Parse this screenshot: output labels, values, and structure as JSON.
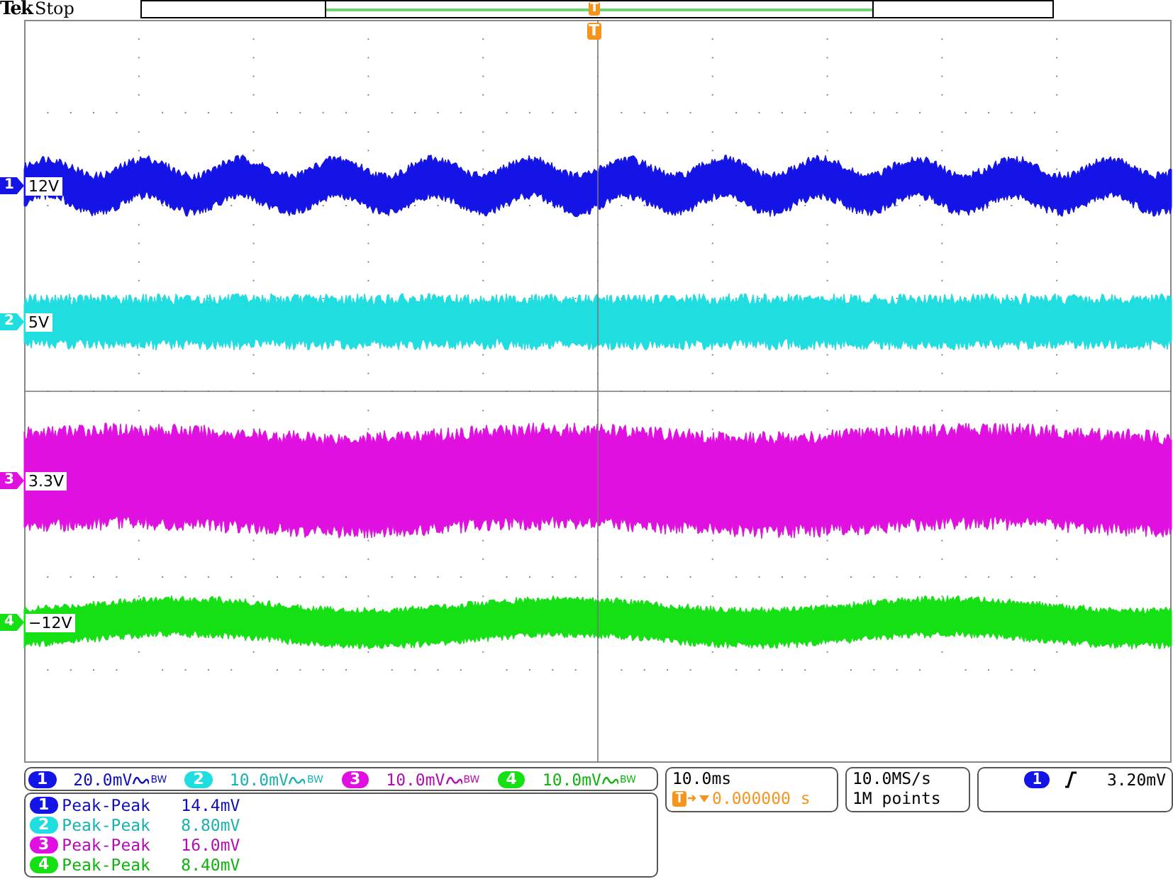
{
  "status": {
    "brand": "Tek",
    "state": "Stop",
    "record_trigger": "T"
  },
  "plot": {
    "trigger_marker": "T"
  },
  "channels": [
    {
      "marker": "1",
      "label": "12V",
      "color": "#1414e6",
      "scale_badge": "1",
      "scale": "20.0mV",
      "bw": "BW",
      "meas_badge": "1",
      "measurement": "Peak-Peak",
      "value": "14.4mV"
    },
    {
      "marker": "2",
      "label": "5V",
      "color": "#20dde0",
      "scale_badge": "2",
      "scale": "10.0mV",
      "bw": "BW",
      "meas_badge": "2",
      "measurement": "Peak-Peak",
      "value": "8.80mV"
    },
    {
      "marker": "3",
      "label": "3.3V",
      "color": "#e010e0",
      "scale_badge": "3",
      "scale": "10.0mV",
      "bw": "BW",
      "meas_badge": "3",
      "measurement": "Peak-Peak",
      "value": "16.0mV"
    },
    {
      "marker": "4",
      "label": "−12V",
      "color": "#14e014",
      "scale_badge": "4",
      "scale": "10.0mV",
      "bw": "BW",
      "meas_badge": "4",
      "measurement": "Peak-Peak",
      "value": "8.40mV"
    }
  ],
  "timebase": {
    "scale": "10.0ms",
    "marker": "T",
    "position": "0.000000 s"
  },
  "acquisition": {
    "sample_rate": "10.0MS/s",
    "record_length": "1M points"
  },
  "trigger": {
    "source": "1",
    "level": "3.20mV"
  }
}
